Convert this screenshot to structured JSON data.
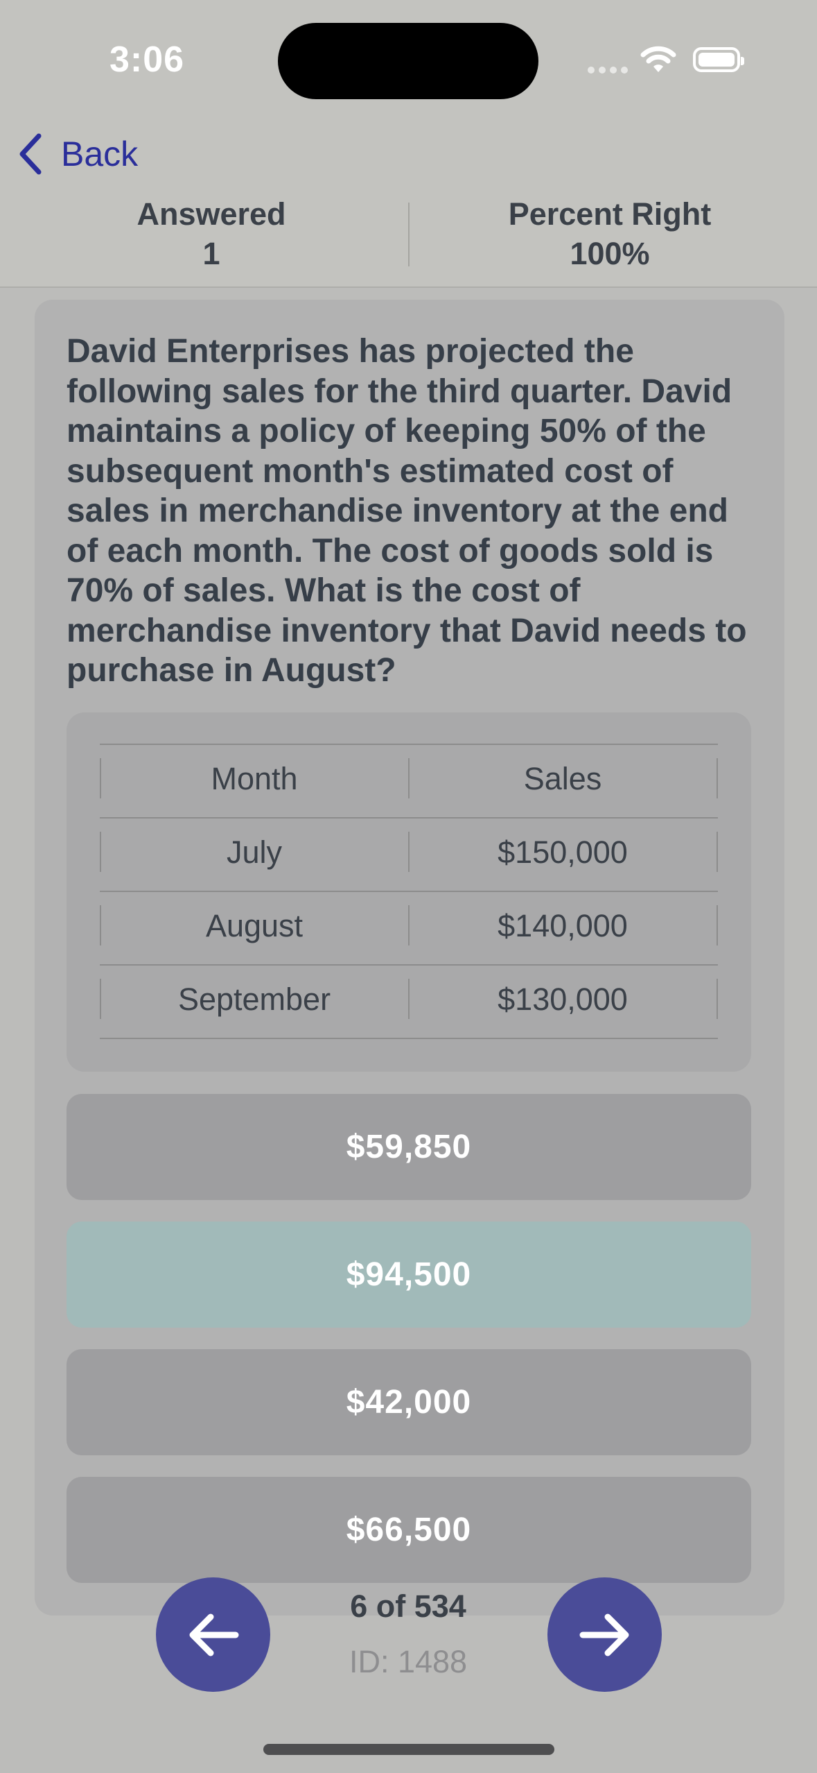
{
  "status_bar": {
    "time": "3:06"
  },
  "nav": {
    "back_label": "Back"
  },
  "stats": {
    "answered_label": "Answered",
    "answered_value": "1",
    "percent_label": "Percent Right",
    "percent_value": "100%"
  },
  "question": {
    "text": "David Enterprises has projected the following sales for the third quarter. David maintains a policy of keeping 50% of the subsequent month's estimated cost of sales in merchandise inventory at the end of each month. The cost of goods sold is 70% of sales. What is the cost of merchandise inventory that David needs to purchase in August?"
  },
  "table": {
    "headers": [
      "Month",
      "Sales"
    ],
    "rows": [
      [
        "July",
        "$150,000"
      ],
      [
        "August",
        "$140,000"
      ],
      [
        "September",
        "$130,000"
      ]
    ]
  },
  "answers": [
    {
      "label": "$59,850",
      "selected": false
    },
    {
      "label": "$94,500",
      "selected": true
    },
    {
      "label": "$42,000",
      "selected": false
    },
    {
      "label": "$66,500",
      "selected": false
    }
  ],
  "pager": {
    "counter": "6 of 534",
    "id_label": "ID: 1488"
  },
  "icons": {
    "back": "chevron-left-icon",
    "prev": "arrow-left-icon",
    "next": "arrow-right-icon"
  },
  "colors": {
    "accent": "#4a4c98",
    "back_link": "#2a2e9a",
    "selected_answer": "#a1bab9",
    "answer": "#9e9ea0"
  }
}
